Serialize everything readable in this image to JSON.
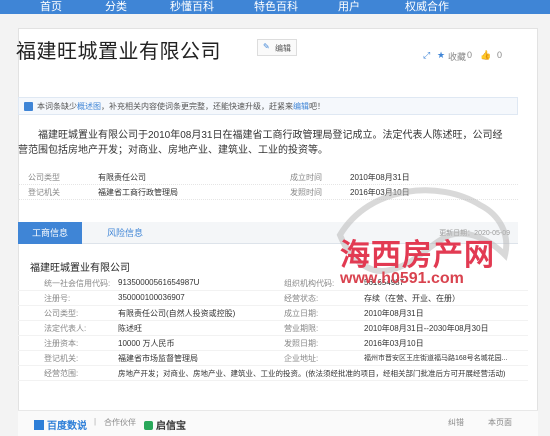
{
  "nav": {
    "items": [
      "首页",
      "分类",
      "秒懂百科",
      "特色百科",
      "用户",
      "权威合作"
    ]
  },
  "share": {
    "favorite_label": "收藏",
    "favorite_count": "0",
    "like_count": "0"
  },
  "title": "福建旺城置业有限公司",
  "edit_label": "编辑",
  "notice": {
    "text": "本词条缺少",
    "link1": "概述图",
    "text2": "，补充相关内容使词条更完整，还能快速升级，赶紧来",
    "link2": "编辑",
    "text3": "吧！"
  },
  "intro": "福建旺城置业有限公司于2010年08月31日在福建省工商行政管理局登记成立。法定代表人陈述旺，公司经营范围包括房地产开发；对商业、房地产业、建筑业、工业的投资等。",
  "keyinfo": [
    {
      "l1": "公司类型",
      "v1": "有限责任公司",
      "l2": "成立时间",
      "v2": "2010年08月31日"
    },
    {
      "l1": "登记机关",
      "v1": "福建省工商行政管理局",
      "l2": "发照时间",
      "v2": "2016年03月10日"
    }
  ],
  "tabs": {
    "active": "工商信息",
    "inactive": "风险信息",
    "updated": "更新日期：2020-05-09"
  },
  "company_name": "福建旺城置业有限公司",
  "details": [
    {
      "l1": "统一社会信用代码:",
      "v1": "91350000561654987U",
      "l2": "组织机构代码:",
      "v2": "561654987"
    },
    {
      "l1": "注册号:",
      "v1": "350000100036907",
      "l2": "经营状态:",
      "v2": "存续（在营、开业、在册）"
    },
    {
      "l1": "公司类型:",
      "v1": "有限责任公司(自然人投资或控股)",
      "l2": "成立日期:",
      "v2": "2010年08月31日"
    },
    {
      "l1": "法定代表人:",
      "v1": "陈述旺",
      "l2": "营业期限:",
      "v2": "2010年08月31日--2030年08月30日"
    },
    {
      "l1": "注册资本:",
      "v1": "10000 万人民币",
      "l2": "发照日期:",
      "v2": "2016年03月10日"
    },
    {
      "l1": "登记机关:",
      "v1": "福建省市场监督管理局",
      "l2": "企业地址:",
      "v2": "福州市晋安区王庄街道福马路168号名城花园..."
    },
    {
      "l1": "经营范围:",
      "v1": "房地产开发；对商业、房地产业、建筑业、工业的投资。(依法须经批准的项目，经相关部门批准后方可开展经营活动)",
      "l2": "",
      "v2": ""
    }
  ],
  "footer": {
    "logo1": "百度数说",
    "sep": "|",
    "partner": "合作伙伴",
    "logo2": "启信宝",
    "right1": "纠错",
    "right2": "本页面"
  },
  "watermark": {
    "text": "海西房产网",
    "url": "www.h0591.com"
  }
}
